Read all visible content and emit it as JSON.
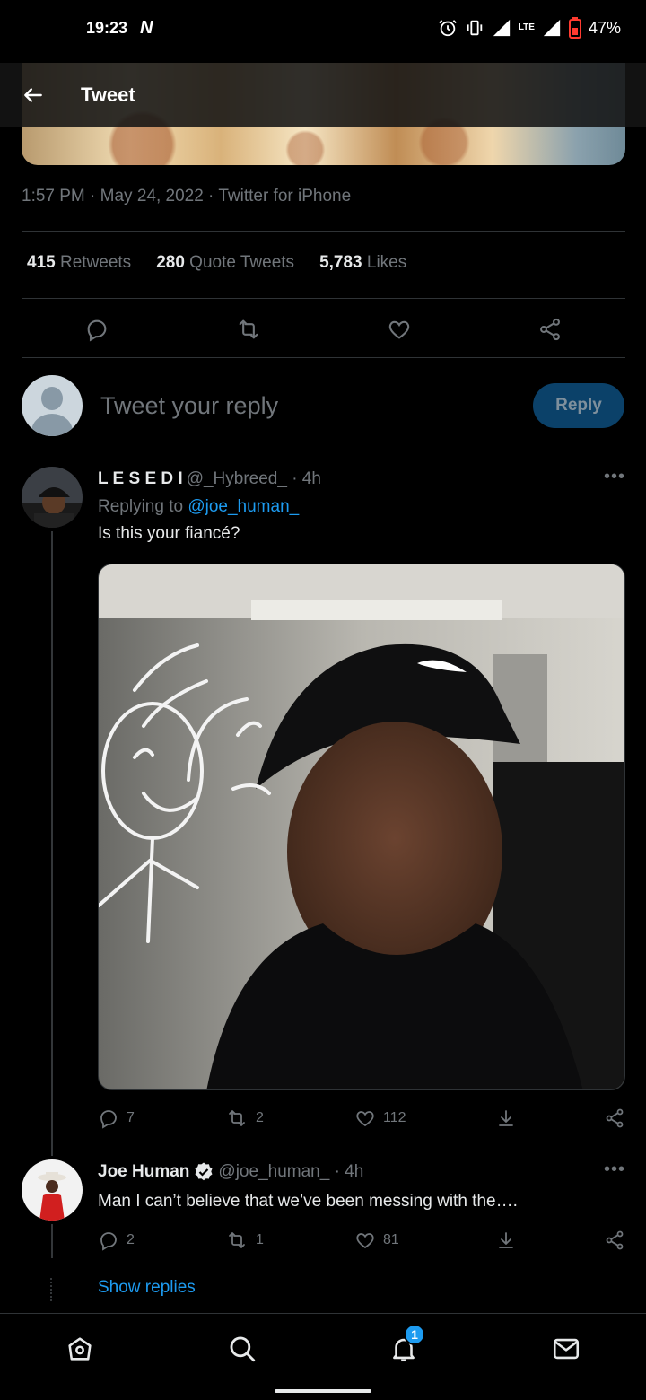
{
  "status_bar": {
    "time": "19:23",
    "network": "LTE",
    "battery": "47%"
  },
  "header": {
    "title": "Tweet"
  },
  "main_tweet": {
    "meta": "1:57 PM · May 24, 2022 · Twitter for iPhone",
    "retweets_count": "415",
    "retweets_label": "Retweets",
    "quotes_count": "280",
    "quotes_label": "Quote Tweets",
    "likes_count": "5,783",
    "likes_label": "Likes"
  },
  "compose": {
    "placeholder": "Tweet your reply",
    "button": "Reply"
  },
  "replies": [
    {
      "name": "L E S E D I",
      "handle": "@_Hybreed_ · 4h",
      "replying_prefix": "Replying to",
      "replying_to": "@joe_human_",
      "text": "Is this your fiancé?",
      "reply_count": "7",
      "retweet_count": "2",
      "like_count": "112"
    },
    {
      "name": "Joe Human",
      "handle": "@joe_human_ · 4h",
      "text": "Man I can’t believe that we’ve been messing with the….",
      "reply_count": "2",
      "retweet_count": "1",
      "like_count": "81"
    }
  ],
  "show_replies": "Show replies",
  "bottom_nav": {
    "notifications_badge": "1"
  },
  "colors": {
    "accent": "#1d9bf0",
    "muted": "#71767b",
    "background": "#000000",
    "reply_button_bg": "#0b4169"
  },
  "icons": [
    "back-arrow-icon",
    "reply-icon",
    "retweet-icon",
    "like-icon",
    "share-icon",
    "download-icon",
    "more-icon",
    "verified-icon",
    "home-icon",
    "search-icon",
    "bell-icon",
    "mail-icon"
  ]
}
